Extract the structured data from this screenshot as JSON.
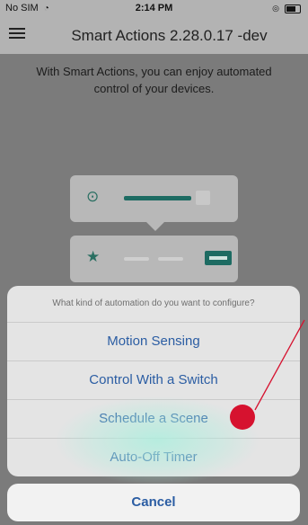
{
  "status_bar": {
    "carrier": "No SIM",
    "time": "2:14 PM"
  },
  "header": {
    "title": "Smart Actions 2.28.0.17 -dev"
  },
  "intro": {
    "text": "With Smart Actions, you can enjoy automated control of your devices."
  },
  "sheet": {
    "question": "What kind of automation do you want to configure?",
    "options": [
      {
        "label": "Motion Sensing"
      },
      {
        "label": "Control With a Switch"
      },
      {
        "label": "Schedule a Scene"
      },
      {
        "label": "Auto-Off Timer"
      }
    ],
    "cancel_label": "Cancel"
  },
  "colors": {
    "accent": "#2b5da3",
    "teal": "#1d6b62",
    "annotation": "#d6122f"
  },
  "icons": [
    "wifi-icon",
    "alarm-icon",
    "battery-icon",
    "menu-icon",
    "bulb-icon",
    "running-person-icon"
  ]
}
